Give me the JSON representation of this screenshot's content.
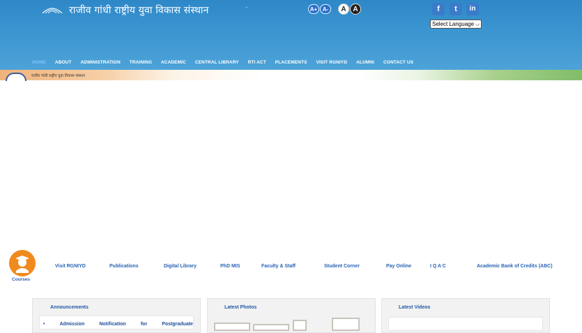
{
  "header": {
    "site_title": "राजीव गांधी राष्ट्रीय युवा विकास संस्थान",
    "font_increase": "A+",
    "font_decrease": "A-",
    "contrast_light": "A",
    "contrast_dark": "A",
    "social": {
      "facebook": "f",
      "twitter": "t",
      "linkedin": "in"
    },
    "language_select": "Select Language"
  },
  "nav": {
    "items": [
      "HOME",
      "ABOUT",
      "ADMINISTRATION",
      "TRAINING",
      "ACADEMIC",
      "CENTRAL LIBRARY",
      "RTI ACT",
      "PLACEMENTS",
      "VISIT RGNIYD",
      "ALUMNI",
      "CONTACT US"
    ]
  },
  "banner": {
    "text": "राजीव गांधी राष्ट्रीय युवा विकास संस्थान"
  },
  "quick_links": {
    "courses": "Courses",
    "items": [
      "Visit RGNIYD",
      "Publications",
      "Digital Library",
      "PhD MIS",
      "Faculty & Staff",
      "Student Corner",
      "Pay Online",
      "I Q A C",
      "Academic Bank of Credits (ABC)"
    ]
  },
  "panels": {
    "announcements": {
      "title": "Announcements",
      "first_item": [
        "Admission",
        "Notification",
        "for",
        "Postgraduate"
      ]
    },
    "photos": {
      "title": "Latest Photos"
    },
    "videos": {
      "title": "Latest Videos"
    }
  },
  "colors": {
    "header_blue": "#3b95d0",
    "link_blue": "#2a63b5",
    "courses_orange": "#f08a1c"
  }
}
